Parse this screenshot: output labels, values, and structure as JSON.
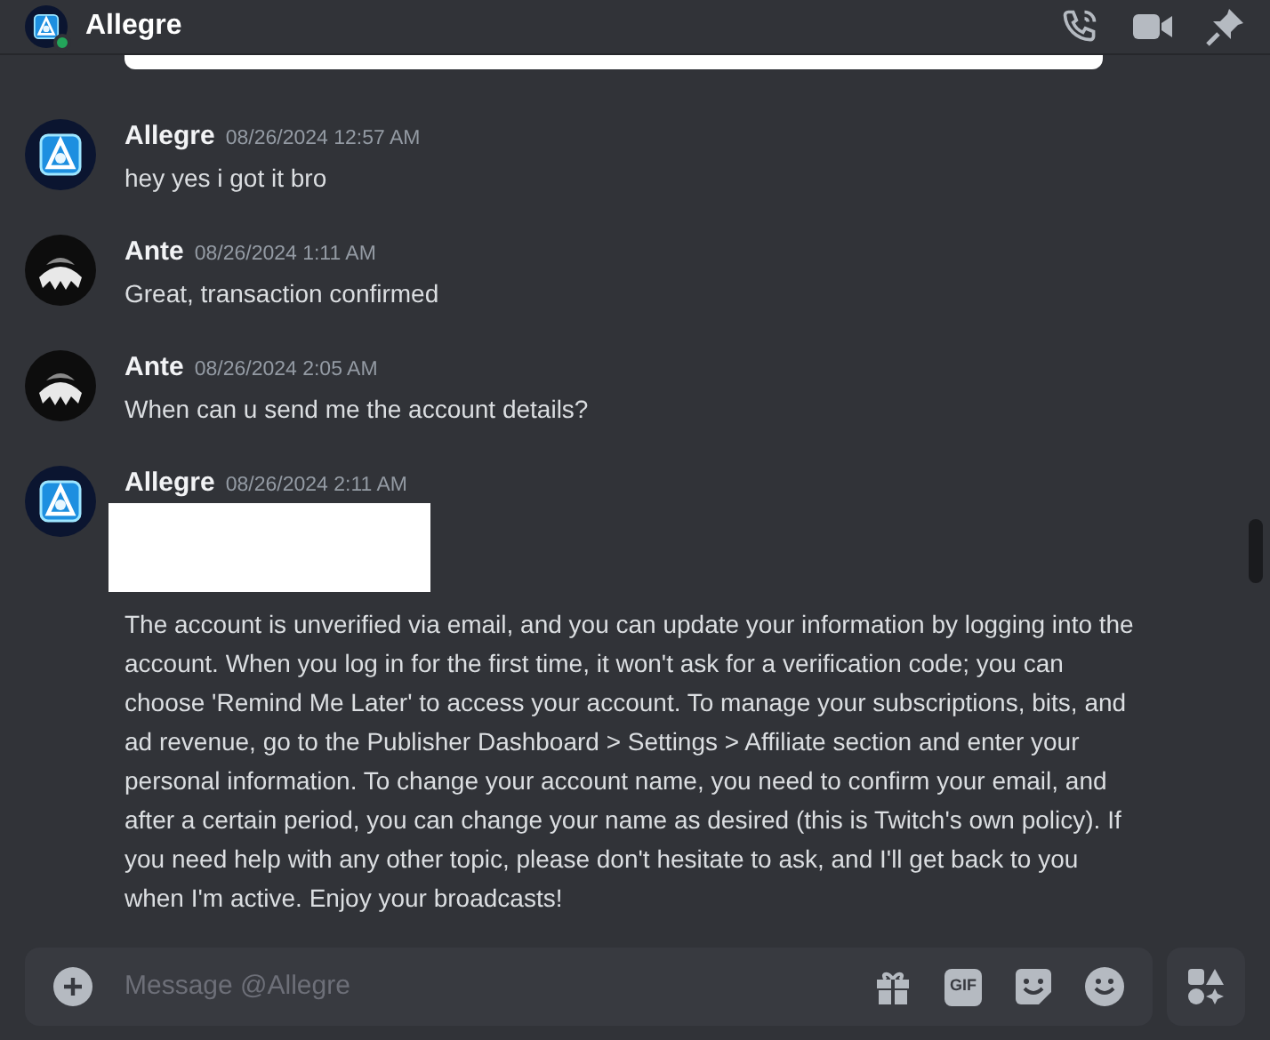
{
  "header": {
    "title": "Allegre",
    "online": true
  },
  "messages": [
    {
      "author": "Allegre",
      "kind": "logo",
      "timestamp": "08/26/2024 12:57 AM",
      "text": "hey yes i got it bro",
      "redacted": false
    },
    {
      "author": "Ante",
      "kind": "dark",
      "timestamp": "08/26/2024 1:11 AM",
      "text": "Great, transaction confirmed",
      "redacted": false
    },
    {
      "author": "Ante",
      "kind": "dark",
      "timestamp": "08/26/2024 2:05 AM",
      "text": "When can u send me the account details?",
      "redacted": false
    },
    {
      "author": "Allegre",
      "kind": "logo",
      "timestamp": "08/26/2024 2:11 AM",
      "text": "The account is unverified via email, and you can update your information by logging into the account. When you log in for the first time, it won't ask for a verification code; you can choose 'Remind Me Later' to access your account. To manage your subscriptions, bits, and ad revenue, go to the Publisher Dashboard > Settings > Affiliate section and enter your personal information. To change your account name, you need to confirm your email, and after a certain period, you can change your name as desired (this is Twitch's own policy). If you need help with any other topic, please don't hesitate to ask, and I'll get back to you when I'm active. Enjoy your broadcasts!",
      "redacted": true
    }
  ],
  "composer": {
    "placeholder": "Message @Allegre",
    "gif_label": "GIF"
  }
}
